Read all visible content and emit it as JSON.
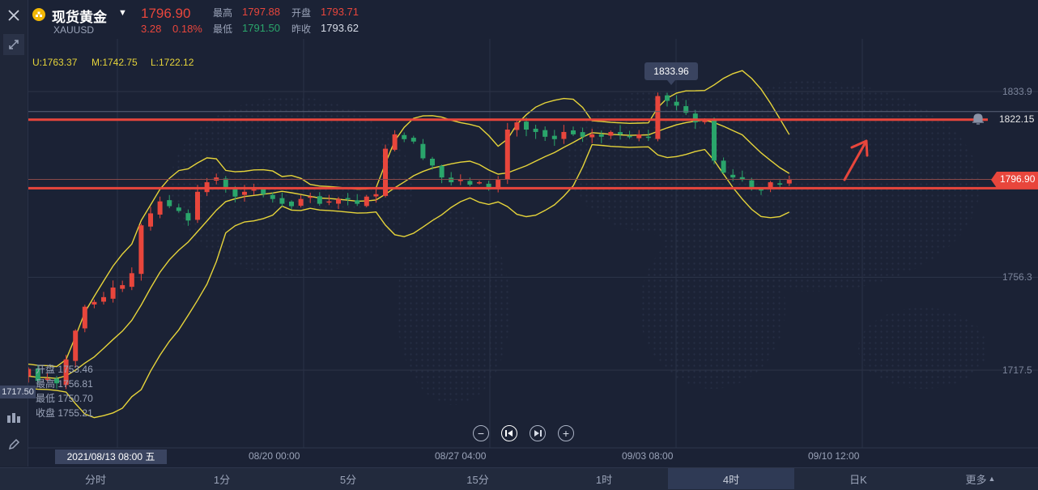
{
  "header": {
    "symbol_name": "现货黄金",
    "symbol_code": "XAUUSD",
    "last_price": "1796.90",
    "change": "3.28",
    "change_pct": "0.18%",
    "high_label": "最高",
    "high_value": "1797.88",
    "open_label": "开盘",
    "open_value": "1793.71",
    "low_label": "最低",
    "low_value": "1791.50",
    "prev_close_label": "昨收",
    "prev_close_value": "1793.62"
  },
  "bollinger": {
    "upper": "U:1763.37",
    "middle": "M:1742.75",
    "lower": "L:1722.12"
  },
  "crosshair": {
    "open_label": "开盘",
    "open_value": "1753.46",
    "high_label": "最高",
    "high_value": "1756.81",
    "low_label": "最低",
    "low_value": "1750.70",
    "close_label": "收盘",
    "close_value": "1755.21",
    "date_label": "2021/08/13 08:00 五",
    "left_price": "1717.50"
  },
  "price_axis": [
    "1833.9",
    "1756.3",
    "1717.5"
  ],
  "alert_price": "1822.15",
  "current_price_tag": "1796.90",
  "max_marker": "1833.96",
  "time_axis": [
    "08/20 00:00",
    "08/27 04:00",
    "09/03 08:00",
    "09/10 12:00"
  ],
  "tabs": [
    "分时",
    "1分",
    "5分",
    "15分",
    "1时",
    "4时",
    "日K",
    "更多"
  ],
  "active_tab": "4时",
  "colors": {
    "up": "#e8463c",
    "down": "#2aa56b",
    "band": "#e6d43a",
    "support": "#e8463c"
  },
  "chart_data": {
    "type": "candlestick",
    "title": "",
    "xlabel": "",
    "ylabel": "",
    "x_ticks": [
      "08/20 00:00",
      "08/27 04:00",
      "09/03 08:00",
      "09/10 12:00"
    ],
    "y_ticks": [
      1833.9,
      1756.3,
      1717.5
    ],
    "ylim": [
      1694,
      1845
    ],
    "horizontal_lines": [
      1822.15,
      1793.5
    ],
    "price_path": [
      1712,
      1715,
      1718,
      1713,
      1714,
      1712,
      1722,
      1734,
      1744,
      1746,
      1748,
      1752,
      1753,
      1758,
      1778,
      1783,
      1788,
      1786,
      1784,
      1780,
      1792,
      1796,
      1798,
      1794,
      1790,
      1792,
      1793,
      1791,
      1789,
      1787,
      1786,
      1789,
      1790,
      1787,
      1788,
      1789,
      1789,
      1787,
      1790,
      1791,
      1810,
      1816,
      1814,
      1813,
      1806,
      1803,
      1798,
      1796,
      1797,
      1795,
      1796,
      1793,
      1797,
      1818,
      1821,
      1818,
      1817,
      1815,
      1814,
      1817,
      1816,
      1815,
      1816,
      1815,
      1817,
      1816,
      1815,
      1816,
      1815,
      1832,
      1830,
      1828,
      1825,
      1821,
      1822,
      1805,
      1800,
      1798,
      1797,
      1794,
      1793,
      1796,
      1795,
      1797
    ]
  }
}
